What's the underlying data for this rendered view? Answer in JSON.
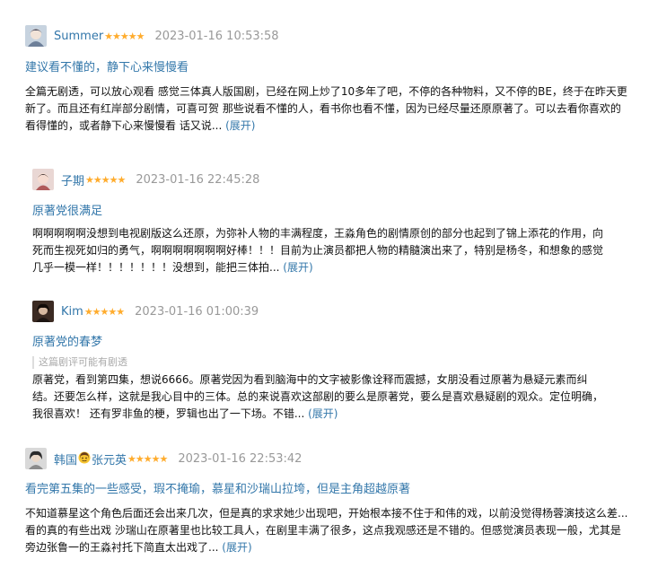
{
  "reviews": [
    {
      "author": "Summer",
      "stars": "★★★★★",
      "time": "2023-01-16 10:53:58",
      "title": "建议看不懂的，静下心来慢慢看",
      "body": "全篇无剧透，可以放心观看 感觉三体真人版国剧，已经在网上炒了10多年了吧，不停的各种物料，又不停的BE，终于在昨天更新了。而且还有红岸部分剧情，可喜可贺 那些说看不懂的人，看书你也看不懂，因为已经尽量还原原著了。可以去看你喜欢的看得懂的，或者静下心来慢慢看 话又说...",
      "expand": "(展开)"
    },
    {
      "author": "子期",
      "stars": "★★★★★",
      "time": "2023-01-16 22:45:28",
      "title": "原著党很满足",
      "body": "啊啊啊啊啊没想到电视剧版这么还原，为弥补人物的丰满程度，王淼角色的剧情原创的部分也起到了锦上添花的作用，向死而生视死如归的勇气，啊啊啊啊啊啊啊好棒！！！目前为止演员都把人物的精髓演出来了，特别是杨冬，和想象的感觉几乎一模一样！！！！！！！没想到，能把三体拍...",
      "expand": "(展开)"
    },
    {
      "author": "Kim",
      "stars": "★★★★★",
      "time": "2023-01-16 01:00:39",
      "title": "原著党的春梦",
      "note": "这篇剧评可能有剧透",
      "body": "原著党，看到第四集，想说6666。原著党因为看到脑海中的文字被影像诠释而震撼，女朋没看过原著为悬疑元素而纠结。还要怎么样，这就是我心目中的三体。总的来说喜欢这部剧的要么是原著党，要么是喜欢悬疑剧的观众。定位明确，我很喜欢！ 还有罗非鱼的梗，罗辑也出了一下场。不错...",
      "expand": "(展开)"
    },
    {
      "author_prefix": "韩国",
      "author_suffix": "张元英",
      "stars": "★★★★★",
      "time": "2023-01-16 22:53:42",
      "title": "看完第五集的一些感受，瑕不掩瑜，慕星和沙瑞山拉垮，但是主角超越原著",
      "body": "不知道慕星这个角色后面还会出来几次，但是真的求求她少出现吧，开始根本接不住于和伟的戏，以前没觉得杨蓉演技这么差...看的真的有些出戏 沙瑞山在原著里也比较工具人，在剧里丰满了很多，这点我观感还是不错的。但感觉演员表现一般，尤其是旁边张鲁一的王淼衬托下简直太出戏了...",
      "expand": "(展开)"
    }
  ]
}
